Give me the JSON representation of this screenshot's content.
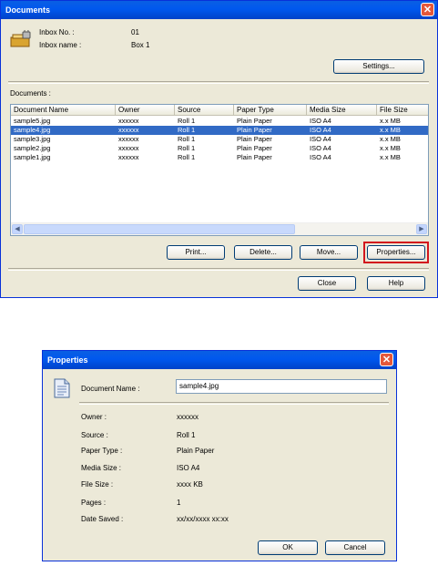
{
  "documents_window": {
    "title": "Documents",
    "inbox_no_label": "Inbox No. :",
    "inbox_no_value": "01",
    "inbox_name_label": "Inbox name :",
    "inbox_name_value": "Box 1",
    "settings_button": "Settings...",
    "documents_label": "Documents :",
    "columns": [
      "Document Name",
      "Owner",
      "Source",
      "Paper Type",
      "Media Size",
      "File Size"
    ],
    "rows": [
      [
        "sample5.jpg",
        "xxxxxx",
        "Roll 1",
        "Plain Paper",
        "ISO A4",
        "x.x MB"
      ],
      [
        "sample4.jpg",
        "xxxxxx",
        "Roll 1",
        "Plain Paper",
        "ISO A4",
        "x.x MB"
      ],
      [
        "sample3.jpg",
        "xxxxxx",
        "Roll 1",
        "Plain Paper",
        "ISO A4",
        "x.x MB"
      ],
      [
        "sample2.jpg",
        "xxxxxx",
        "Roll 1",
        "Plain Paper",
        "ISO A4",
        "x.x MB"
      ],
      [
        "sample1.jpg",
        "xxxxxx",
        "Roll 1",
        "Plain Paper",
        "ISO A4",
        "x.x MB"
      ]
    ],
    "selected_row": 1,
    "print_button": "Print...",
    "delete_button": "Delete...",
    "move_button": "Move...",
    "properties_button": "Properties...",
    "close_button": "Close",
    "help_button": "Help"
  },
  "properties_dialog": {
    "title": "Properties",
    "document_name_label": "Document Name :",
    "document_name_value": "sample4.jpg",
    "owner_label": "Owner :",
    "owner_value": "xxxxxx",
    "source_label": "Source :",
    "source_value": "Roll 1",
    "paper_type_label": "Paper Type :",
    "paper_type_value": "Plain Paper",
    "media_size_label": "Media Size :",
    "media_size_value": "ISO A4",
    "file_size_label": "File Size :",
    "file_size_value": "xxxx KB",
    "pages_label": "Pages :",
    "pages_value": "1",
    "date_saved_label": "Date Saved :",
    "date_saved_value": "xx/xx/xxxx xx:xx",
    "ok_button": "OK",
    "cancel_button": "Cancel"
  },
  "colors": {
    "titlebar": "#0058ee",
    "dialog_bg": "#ece9d8",
    "selection": "#316ac5",
    "highlight_box": "#d2161d"
  }
}
